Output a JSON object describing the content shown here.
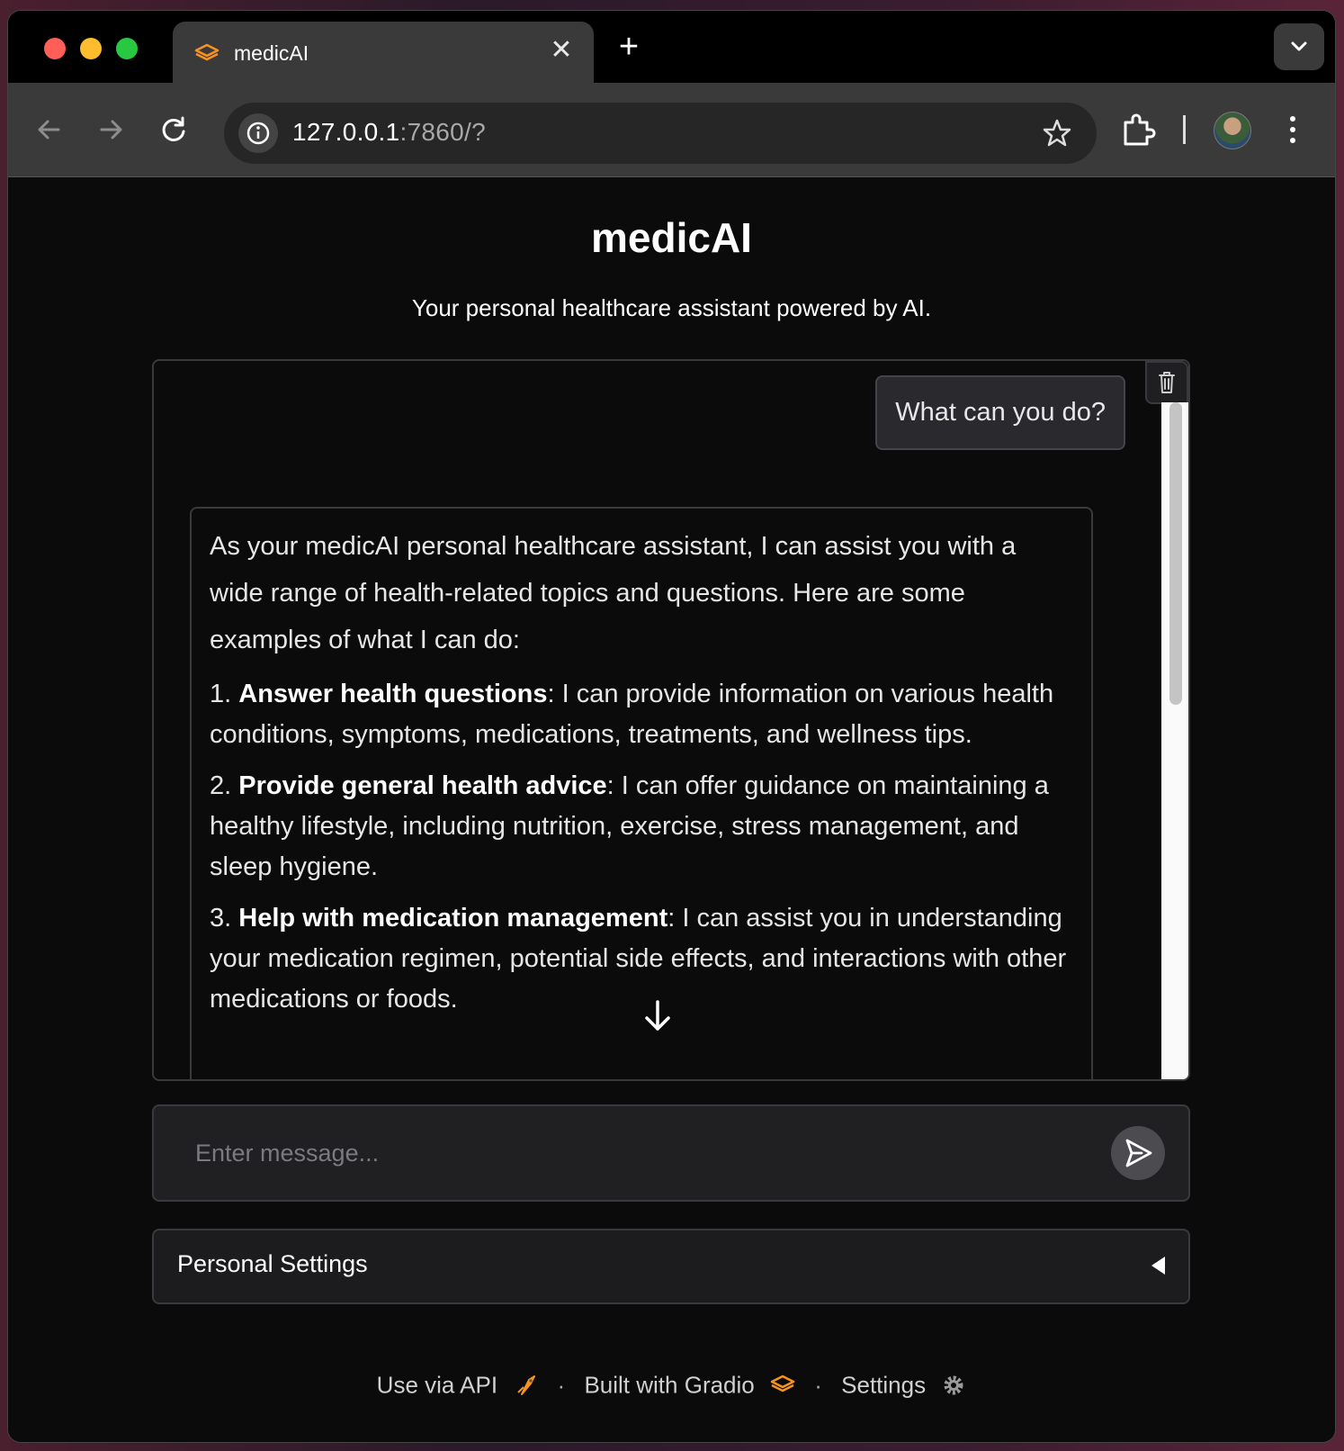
{
  "browser": {
    "tab_title": "medicAI",
    "tab_close": "✕",
    "new_tab": "+",
    "url_host": "127.0.0.1",
    "url_rest": ":7860/?"
  },
  "page": {
    "title": "medicAI",
    "subtitle": "Your personal healthcare assistant powered by AI."
  },
  "chat": {
    "user_message": "What can you do?",
    "bot_intro": "As your medicAI personal healthcare assistant, I can assist you with a wide range of health-related topics and questions. Here are some examples of what I can do:",
    "items": [
      {
        "num": "1.",
        "title": "Answer health questions",
        "text": ": I can provide information on various health conditions, symptoms, medications, treatments, and wellness tips."
      },
      {
        "num": "2.",
        "title": "Provide general health advice",
        "text": ": I can offer guidance on maintaining a healthy lifestyle, including nutrition, exercise, stress management, and sleep hygiene."
      },
      {
        "num": "3.",
        "title": "Help with medication management",
        "text": ": I can assist you in understanding your medication regimen, potential side effects, and interactions with other medications or foods."
      }
    ],
    "input_placeholder": "Enter message..."
  },
  "accordion": {
    "label": "Personal Settings"
  },
  "footer": {
    "api": "Use via API",
    "built": "Built with Gradio",
    "settings": "Settings",
    "separator": "·"
  },
  "colors": {
    "gradio_orange": "#f7931e",
    "background": "#0b0b0b"
  }
}
